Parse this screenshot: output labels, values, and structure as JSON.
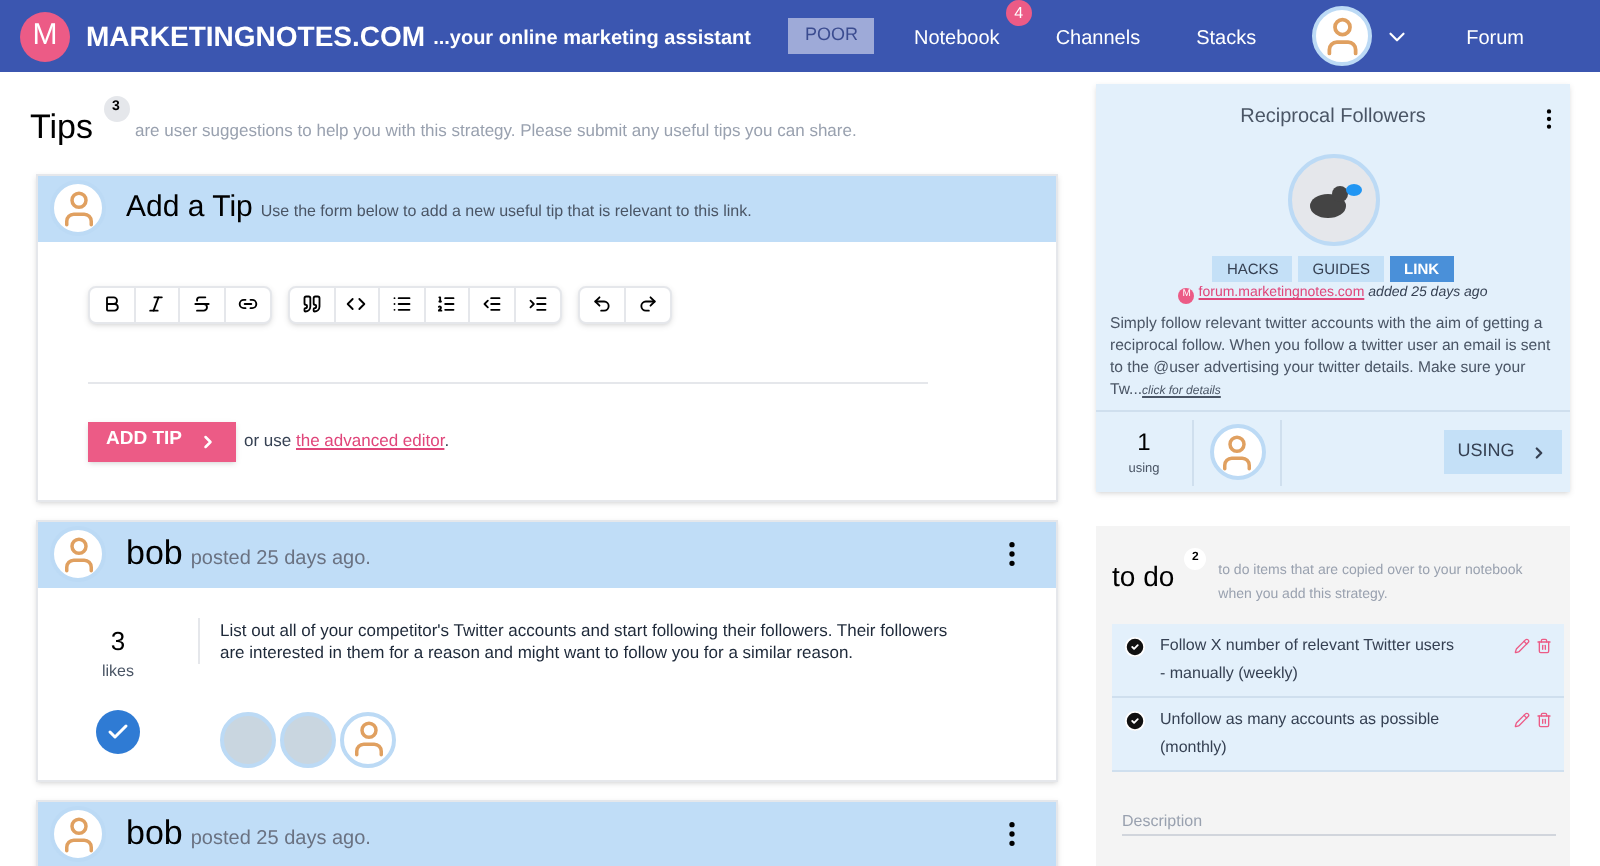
{
  "header": {
    "logo_letter": "M",
    "brand": "MARKETINGNOTES.COM",
    "tagline": "...your online marketing assistant",
    "nav": [
      {
        "kind": "rank",
        "label": "POOR"
      },
      {
        "kind": "link",
        "label": "Notebook",
        "badge": "4"
      },
      {
        "kind": "link",
        "label": "Channels"
      },
      {
        "kind": "link",
        "label": "Stacks"
      },
      {
        "kind": "avatar"
      },
      {
        "kind": "link",
        "label": "Forum"
      }
    ]
  },
  "tips": {
    "title": "Tips",
    "count": "3",
    "subtitle": "are user suggestions to help you with this strategy. Please submit any useful tips you can share.",
    "add_tip": {
      "title": "Add a Tip",
      "hint": "Use the form below to add a new useful tip that is relevant to this link.",
      "button": "ADD TIP",
      "or_text": "or use",
      "link": "the advanced editor",
      "after_link": "."
    },
    "posts": [
      {
        "author": "bob",
        "posted": "posted 25 days ago.",
        "likes": "3",
        "likes_label": "likes",
        "liked": true,
        "text": "List out all of your competitor's Twitter accounts and start following their followers. Their followers are interested in them for a reason and might want to follow you for a similar reason.",
        "likers": [
          {
            "kind": "photo"
          },
          {
            "kind": "photo"
          },
          {
            "kind": "cartoon"
          }
        ]
      },
      {
        "author": "bob",
        "posted": "posted 25 days ago."
      }
    ]
  },
  "strategy": {
    "title": "Reciprocal Followers",
    "tags": [
      {
        "label": "HACKS",
        "selected": false
      },
      {
        "label": "GUIDES",
        "selected": false
      },
      {
        "label": "LINK",
        "selected": true
      }
    ],
    "source_letter": "M",
    "source": "forum.marketingnotes.com",
    "added": "added 25 days ago",
    "description": "Simply follow relevant twitter accounts with the aim of getting a reciprocal follow. When you follow a twitter user an email is sent to the @user advertising your twitter details. Make sure your Tw...",
    "details_link": "click for details",
    "using_count": "1",
    "using_label": "using",
    "using_button": "USING"
  },
  "todo": {
    "title": "to do",
    "count": "2",
    "subtitle": "to do items that are copied over to your notebook when you add this strategy.",
    "items": [
      {
        "text": "Follow X number of relevant Twitter users - manually (weekly)",
        "checked": true
      },
      {
        "text": "Unfollow as many accounts as possible (monthly)",
        "checked": true
      }
    ],
    "placeholder": "Description"
  }
}
